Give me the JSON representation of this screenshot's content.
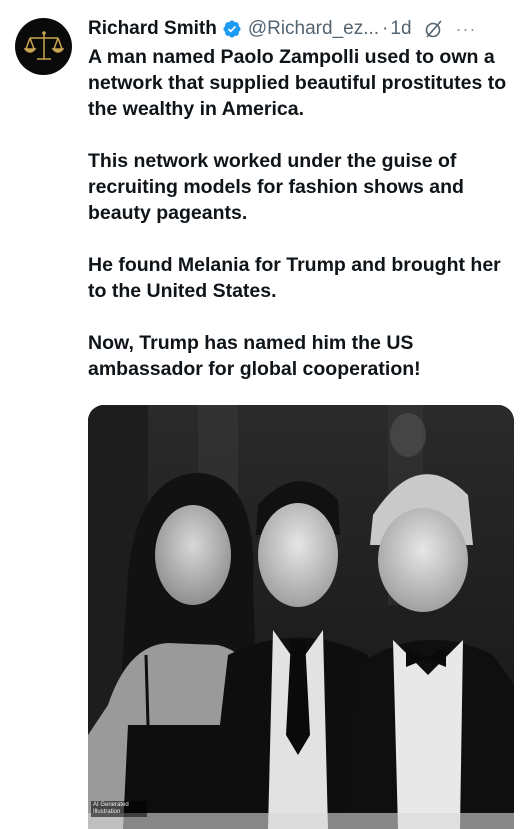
{
  "author": {
    "name": "Richard Smith",
    "handle": "@Richard_ez...",
    "separator": "·",
    "timestamp": "1d",
    "avatar_icon": "scales-of-justice-icon",
    "verified_color": "#1d9bf0"
  },
  "post": {
    "paragraphs": [
      "A man named Paolo Zampolli used to own a network that supplied beautiful prostitutes to the wealthy in America.",
      "This network worked under the guise of recruiting models for fashion shows and beauty pageants.",
      "He found Melania for Trump and brought her to the United States.",
      "Now, Trump has named him the US ambassador for global cooperation!"
    ]
  },
  "media": {
    "watermark": "AI Generated Illustration"
  },
  "icons": {
    "verified": "verified-badge-icon",
    "grok": "grok-icon",
    "more": "more-options-icon"
  },
  "more_label": "···"
}
